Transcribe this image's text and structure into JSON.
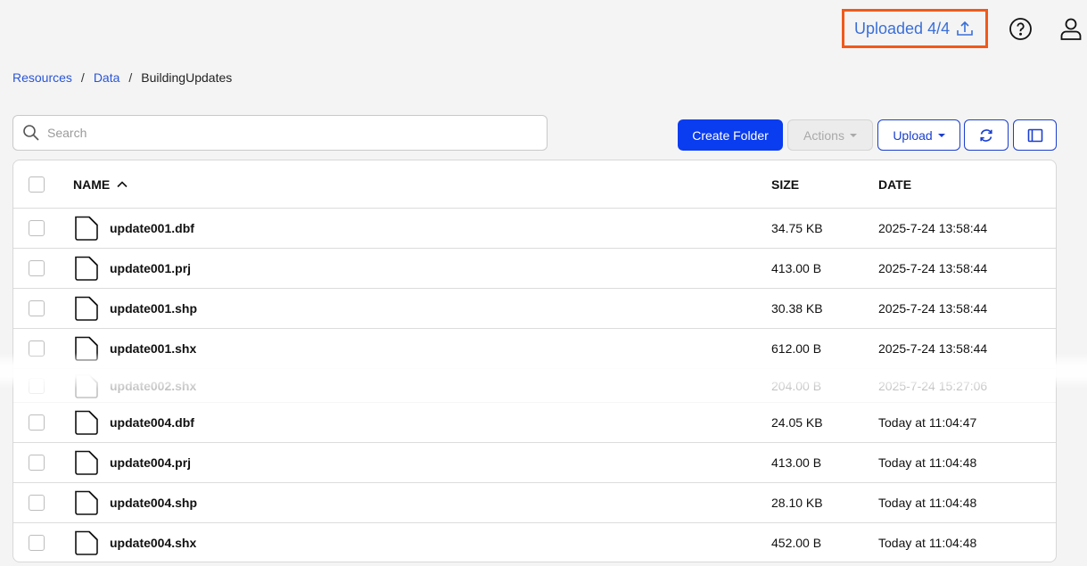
{
  "header": {
    "upload_status": "Uploaded 4/4",
    "upload_icon": "upload-icon",
    "help_icon": "help-icon",
    "user_icon": "user-icon",
    "highlight_color": "#f05a1a"
  },
  "breadcrumb": {
    "items": [
      "Resources",
      "Data"
    ],
    "current": "BuildingUpdates",
    "separator": "/"
  },
  "search": {
    "placeholder": "Search",
    "value": ""
  },
  "toolbar": {
    "create_folder": "Create Folder",
    "actions": "Actions",
    "upload": "Upload",
    "refresh_icon": "refresh-icon",
    "panel_icon": "panel-icon",
    "primary_color": "#0a3cf0"
  },
  "table": {
    "columns": {
      "name": "NAME",
      "size": "SIZE",
      "date": "DATE"
    },
    "sort": "name-ascending",
    "rows": [
      {
        "name": "update001.dbf",
        "size": "34.75 KB",
        "date": "2025-7-24 13:58:44"
      },
      {
        "name": "update001.prj",
        "size": "413.00 B",
        "date": "2025-7-24 13:58:44"
      },
      {
        "name": "update001.shp",
        "size": "30.38 KB",
        "date": "2025-7-24 13:58:44"
      },
      {
        "name": "update001.shx",
        "size": "612.00 B",
        "date": "2025-7-24 13:58:44"
      },
      {
        "name": "update002.shx",
        "size": "204.00 B",
        "date": "2025-7-24 15:27:06"
      },
      {
        "name": "update004.dbf",
        "size": "24.05 KB",
        "date": "Today at 11:04:47"
      },
      {
        "name": "update004.prj",
        "size": "413.00 B",
        "date": "Today at 11:04:48"
      },
      {
        "name": "update004.shp",
        "size": "28.10 KB",
        "date": "Today at 11:04:48"
      },
      {
        "name": "update004.shx",
        "size": "452.00 B",
        "date": "Today at 11:04:48"
      }
    ]
  }
}
